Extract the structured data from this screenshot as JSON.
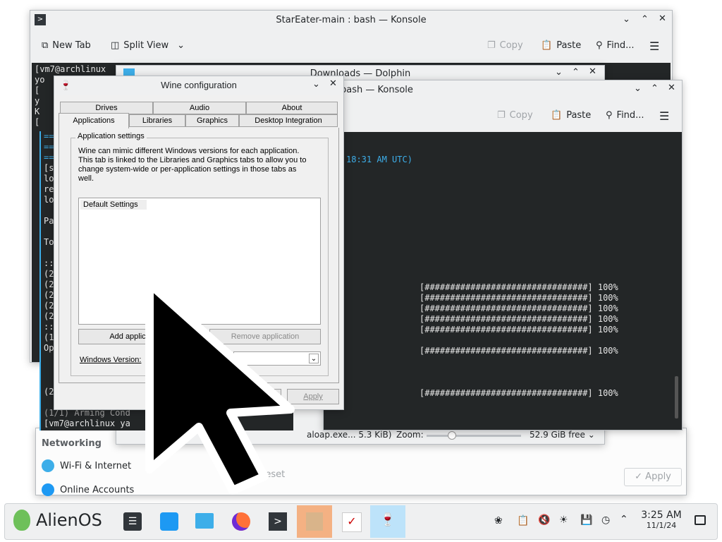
{
  "konsole_back": {
    "title": "StarEater-main : bash — Konsole",
    "new_tab": "New Tab",
    "split_view": "Split View",
    "copy": "Copy",
    "paste": "Paste",
    "find": "Find...",
    "lines": [
      "[vm7@archlinux",
      "yo",
      "[",
      "y",
      "K",
      "["
    ],
    "mid_lines": [
      "[s",
      "lo",
      "re",
      "lo",
      "",
      "Pa",
      "",
      "To",
      "",
      "::",
      "(2",
      "(2",
      "(2",
      "(2",
      "(2",
      "::",
      "(1",
      "Op"
    ],
    "bottom_lines": [
      "(2",
      "(1/1) Arming Cond",
      "[vm7@archlinux ya"
    ]
  },
  "dolphin": {
    "title": "Downloads — Dolphin",
    "status_file": "aloap.exe... 5.3 KiB)",
    "zoom_label": "Zoom:",
    "free_space": "52.9 GiB free"
  },
  "konsole_front": {
    "title": "bash — Konsole",
    "copy": "Copy",
    "paste": "Paste",
    "find": "Find...",
    "time_text": "18:31 AM UTC)",
    "progress_line": "[################################] 100%"
  },
  "settings": {
    "networking": "Networking",
    "wifi": "Wi-Fi & Internet",
    "online_accounts": "Online Accounts",
    "reset": "Reset",
    "apply": "Apply"
  },
  "wine": {
    "title": "Wine configuration",
    "tabs_row1": [
      "Drives",
      "Audio",
      "About"
    ],
    "tabs_row2": [
      "Applications",
      "Libraries",
      "Graphics",
      "Desktop Integration"
    ],
    "group_label": "Application settings",
    "description": "Wine can mimic different Windows versions for each application. This tab is linked to the Libraries and Graphics tabs to allow you to change system-wide or per-application settings in those tabs as well.",
    "list_item": "Default Settings",
    "add_app": "Add applic",
    "remove_app": "Remove application",
    "windows_version": "Windows Version:",
    "apply": "Apply"
  },
  "taskbar": {
    "launcher": "AlienOS",
    "time": "3:25 AM",
    "date": "11/1/24"
  }
}
